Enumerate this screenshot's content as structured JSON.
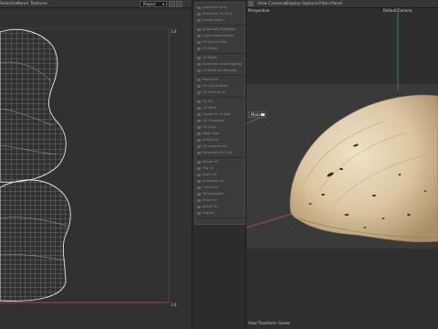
{
  "uv_editor": {
    "menu": [
      "Selection",
      "Panel",
      "Textures"
    ],
    "dropdown": "Project",
    "coord_top": "1.0",
    "coord_bottom": "1.0"
  },
  "tool_list": {
    "groups": [
      [
        "Load Gold Grid",
        "Subdivide UV Grid",
        "Create Shells"
      ],
      [
        "Automatic Projection",
        "Layout Keep Aspect",
        "UV Size to Grid",
        "UV Mirror"
      ],
      [
        "UV Relax",
        "Automatic Auto Mapping",
        "UV Relax by Mapping"
      ],
      [
        "Planar UV",
        "UV Cut to Shells",
        "UV Shell to UV"
      ],
      [
        "UV Fill",
        "UV Weld",
        "Create UV Unfold",
        "UV Straighten",
        "UV Align",
        "Edge Flow",
        "Unfold UV",
        "UV Layout Grid",
        "Normalize UV Grid"
      ],
      [
        "Rotate UV",
        "Flip UV",
        "Scale UV",
        "Distribute UV",
        "Orient UV",
        "Fit Rectangle",
        "Stack UV",
        "Select UV",
        "Gather"
      ]
    ]
  },
  "viewport": {
    "menu": [
      "View",
      "Cameras",
      "Display",
      "Options",
      "Filters",
      "Panel"
    ],
    "view_name": "Perspective",
    "camera_name": "Default Camera",
    "move_label": "Move",
    "status_text": "View Transform: Scene"
  },
  "colors": {
    "panel_bg": "#313131",
    "viewport_bg": "#333333",
    "uv_wire": "#d8d8d8",
    "axis_red": "#c0505a",
    "axis_teal": "#3c8c86",
    "almond": "#d8c3a0"
  }
}
